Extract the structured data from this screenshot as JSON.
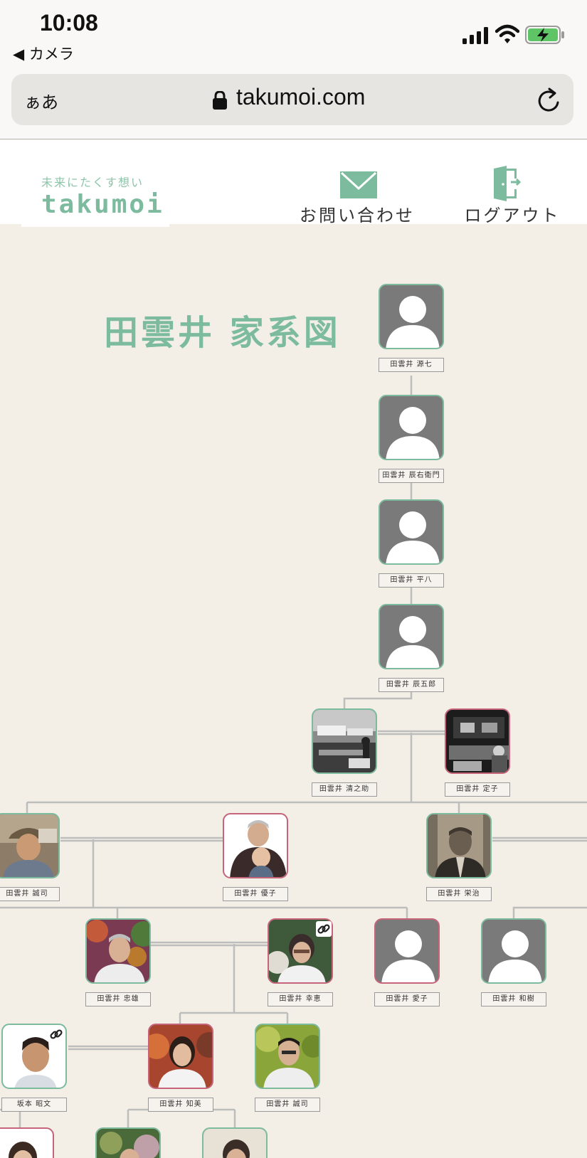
{
  "status_bar": {
    "time": "10:08",
    "back_label": "◀ カメラ"
  },
  "url_bar": {
    "text_size_label": "ぁあ",
    "host": "takumoi.com"
  },
  "header": {
    "tagline": "未来にたくす想い",
    "brand": "takumoi",
    "contact_label": "お問い合わせ",
    "logout_label": "ログアウト"
  },
  "tree": {
    "title": "田雲井 家系図",
    "colors": {
      "male": "#7dbb9f",
      "female": "#c6647a",
      "line": "#bdbdbd",
      "accent": "#7dbb9f"
    },
    "people": [
      {
        "name": "田雲井 源七",
        "gender": "m",
        "photo": "silhouette"
      },
      {
        "name": "田雲井 辰右衛門",
        "gender": "m",
        "photo": "silhouette"
      },
      {
        "name": "田雲井 平八",
        "gender": "m",
        "photo": "silhouette"
      },
      {
        "name": "田雲井 辰五郎",
        "gender": "m",
        "photo": "silhouette"
      },
      {
        "name": "田雲井 清之助",
        "gender": "m",
        "photo": "bw-harbor"
      },
      {
        "name": "田雲井 定子",
        "gender": "f",
        "photo": "bw-shop"
      },
      {
        "name": "田雲井 誠司",
        "gender": "m",
        "photo": "elder-hat"
      },
      {
        "name": "田雲井 優子",
        "gender": "f",
        "photo": "grandma-baby"
      },
      {
        "name": "田雲井 栄治",
        "gender": "m",
        "photo": "sepia-portrait"
      },
      {
        "name": "田雲井 忠雄",
        "gender": "m",
        "photo": "man-autumn"
      },
      {
        "name": "田雲井 幸恵",
        "gender": "f",
        "photo": "woman-glasses",
        "linked": true
      },
      {
        "name": "田雲井 愛子",
        "gender": "f",
        "photo": "silhouette"
      },
      {
        "name": "田雲井 和樹",
        "gender": "m",
        "photo": "silhouette"
      },
      {
        "name": "坂本 昭文",
        "gender": "m",
        "photo": "man-white",
        "linked": true
      },
      {
        "name": "田雲井 知美",
        "gender": "f",
        "photo": "woman-autumn"
      },
      {
        "name": "田雲井 誠司",
        "gender": "m",
        "photo": "young-man"
      },
      {
        "name": "",
        "gender": "f",
        "photo": "woman-partial"
      },
      {
        "name": "",
        "gender": "m",
        "photo": "child-tree"
      },
      {
        "name": "",
        "gender": "m",
        "photo": "man-partial"
      }
    ]
  }
}
